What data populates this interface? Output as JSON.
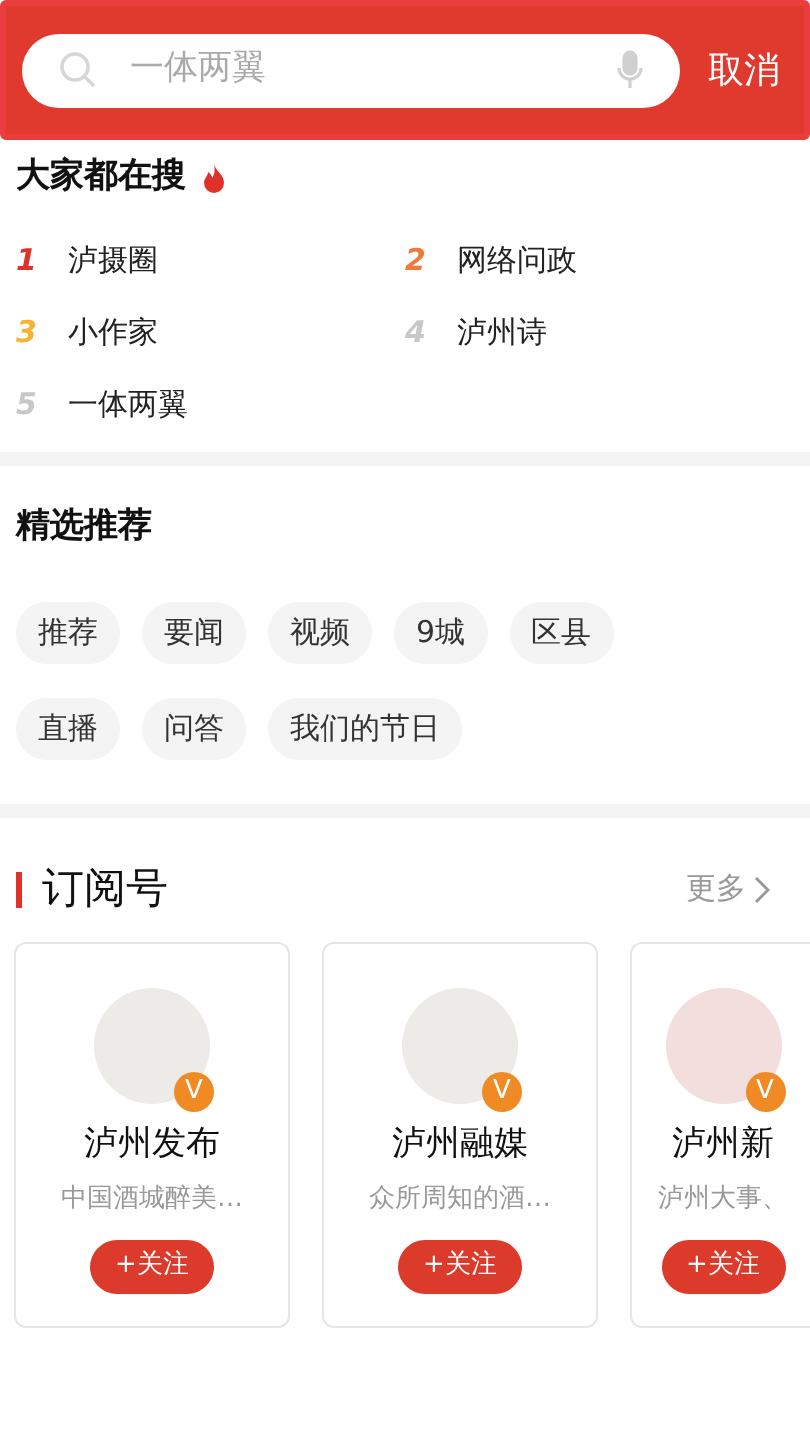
{
  "search": {
    "placeholder": "一体两翼",
    "cancel": "取消"
  },
  "hot": {
    "title": "大家都在搜",
    "items": [
      {
        "rank": "1",
        "label": "泸摄圈",
        "color": "#e0302a"
      },
      {
        "rank": "2",
        "label": "网络问政",
        "color": "#f07a3c"
      },
      {
        "rank": "3",
        "label": "小作家",
        "color": "#f5b335"
      },
      {
        "rank": "4",
        "label": "泸州诗",
        "color": "#c8c8c8"
      },
      {
        "rank": "5",
        "label": "一体两翼",
        "color": "#c8c8c8"
      }
    ]
  },
  "featured": {
    "title": "精选推荐",
    "rows": [
      [
        "推荐",
        "要闻",
        "视频",
        "9城",
        "区县"
      ],
      [
        "直播",
        "问答",
        "我们的节日"
      ]
    ]
  },
  "subscriptions": {
    "title": "订阅号",
    "more": "更多",
    "cards": [
      {
        "name": "泸州发布",
        "desc": "中国酒城醉美…",
        "badge": "V",
        "follow": "+关注"
      },
      {
        "name": "泸州融媒",
        "desc": "众所周知的酒…",
        "badge": "V",
        "follow": "+关注"
      },
      {
        "name": "泸州新",
        "desc": "泸州大事、",
        "badge": "V",
        "follow": "+关注"
      }
    ]
  }
}
